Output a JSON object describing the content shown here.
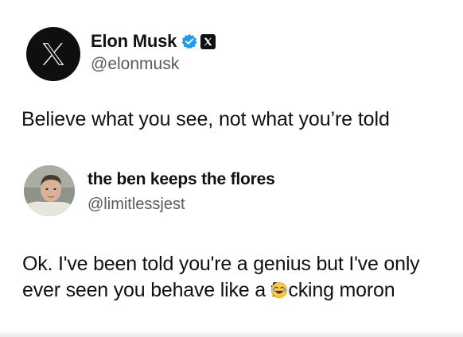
{
  "post1": {
    "author_name": "Elon Musk",
    "handle": "@elonmusk",
    "avatar_icon": "x-logo-icon",
    "badges": [
      "verified-badge-icon",
      "x-affiliation-badge-icon"
    ],
    "text": "Believe what you see, not what you’re told",
    "colors": {
      "verified": "#1d9bf0",
      "avatar_bg": "#0f0f0f"
    }
  },
  "post2": {
    "author_name": "the ben keeps the flores",
    "handle": "@limitlessjest",
    "text_line1": "Ok. I've been told you're a genius but I've only",
    "text_line2_before": "ever seen you behave like a f",
    "text_line2_emoji": "laughing-face-emoji-icon",
    "text_line2_after": "cking moron"
  }
}
